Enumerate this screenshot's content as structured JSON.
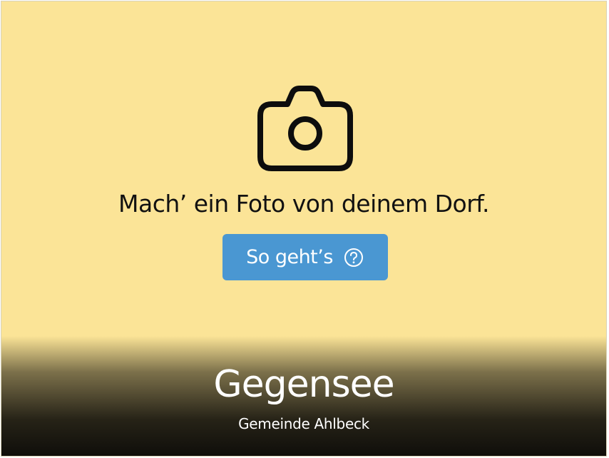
{
  "placeholder": {
    "icon": "camera-icon",
    "prompt": "Mach’ ein Foto von deinem Dorf.",
    "button_label": "So geht’s",
    "button_icon": "help-circle-icon",
    "button_color": "#4a97d2",
    "background_color": "#fbe497"
  },
  "location": {
    "village": "Gegensee",
    "municipality": "Gemeinde Ahlbeck"
  }
}
